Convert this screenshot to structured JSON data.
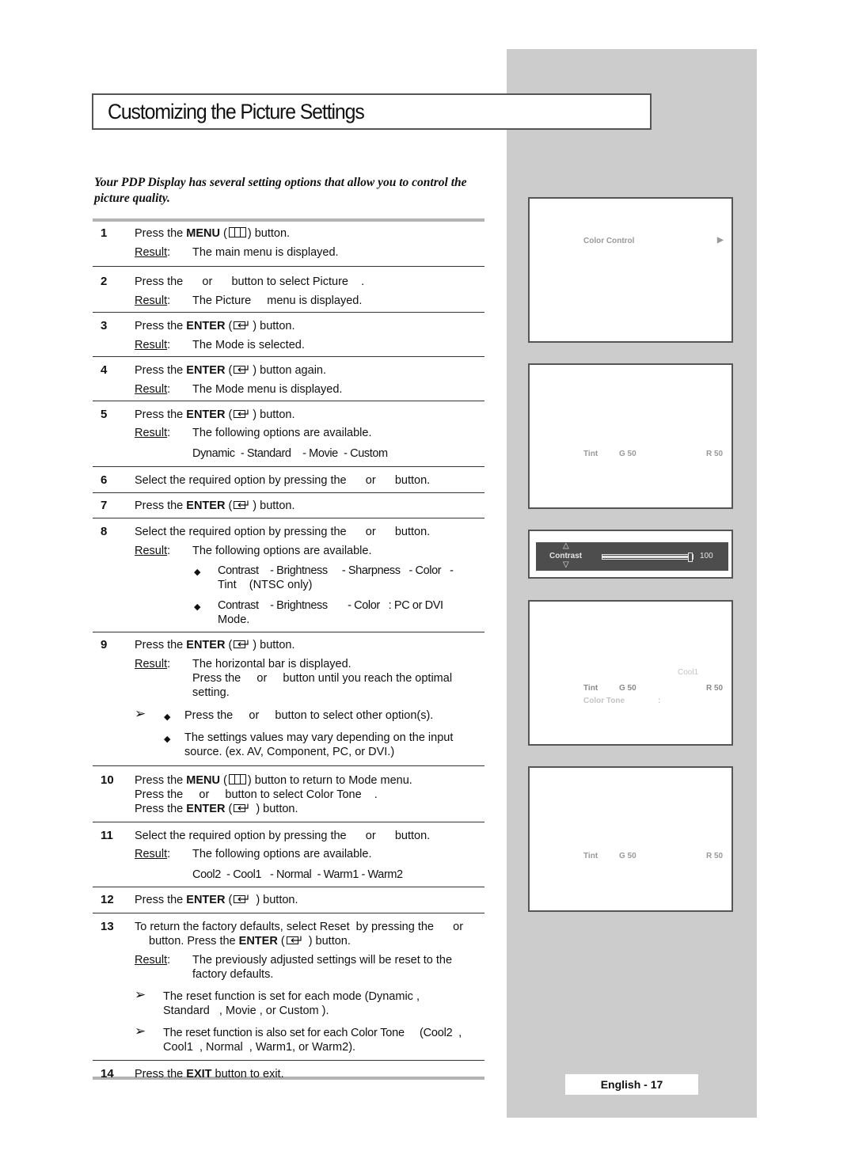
{
  "page": {
    "title": "Customizing the Picture Settings",
    "intro": "Your PDP Display has several setting options that allow you to control the picture quality.",
    "footer_label": "English - 17"
  },
  "icons": {
    "menu": "menu-button-icon",
    "enter": "enter-button-icon",
    "bullet": "◆",
    "note": "➢"
  },
  "steps": [
    {
      "num": "1",
      "l1a": "Press the ",
      "l1b": "MENU",
      "l1c": " (",
      "l1d": ") button.",
      "result_label": "Result",
      "colon": ":",
      "result": "The main menu is displayed."
    },
    {
      "num": "2",
      "l1": "Press the      or      button to select Picture    .",
      "result_label": "Result",
      "colon": ":",
      "result": "The Picture     menu is displayed."
    },
    {
      "num": "3",
      "l1a": "Press the ",
      "l1b": "ENTER",
      "l1c": " (",
      "l1d": ") button.",
      "result_label": "Result",
      "colon": ":",
      "result": "The Mode is selected."
    },
    {
      "num": "4",
      "l1a": "Press the ",
      "l1b": "ENTER",
      "l1c": " (",
      "l1d": ") button again.",
      "result_label": "Result",
      "colon": ":",
      "result": "The Mode menu is displayed."
    },
    {
      "num": "5",
      "l1a": "Press the ",
      "l1b": "ENTER",
      "l1c": " (",
      "l1d": ") button.",
      "result_label": "Result",
      "colon": ":",
      "result": "The following options are available.",
      "options": "Dynamic  - Standard    - Movie  - Custom"
    },
    {
      "num": "6",
      "l1": "Select the required option by pressing the      or      button."
    },
    {
      "num": "7",
      "l1a": "Press the ",
      "l1b": "ENTER",
      "l1c": " (",
      "l1d": ") button."
    },
    {
      "num": "8",
      "l1": "Select the required option by pressing the      or      button.",
      "result_label": "Result",
      "colon": ":",
      "result": "The following options are available.",
      "bullets": [
        {
          "l1": "Contrast    - Brightness     - Sharpness   - Color   -",
          "l2": "Tint    (NTSC only)"
        },
        {
          "l1": "Contrast    - Brightness       - Color   : PC or DVI",
          "l2": "Mode."
        }
      ]
    },
    {
      "num": "9",
      "l1a": "Press the ",
      "l1b": "ENTER",
      "l1c": " (",
      "l1d": ") button.",
      "result_label": "Result",
      "colon": ":",
      "result": "The horizontal bar is displayed.",
      "result2": "Press the     or     button until you reach the optimal",
      "result3": "setting.",
      "notes": [
        {
          "l1": "Press the     or     button to select other option(s)."
        },
        {
          "l1": "The settings values may vary depending on the input",
          "l2": "source. (ex. AV, Component, PC, or DVI.)"
        }
      ]
    },
    {
      "num": "10",
      "l1a": "Press the ",
      "l1b": "MENU",
      "l1c": " (",
      "l1d": ") button to return to Mode menu.",
      "l2": "Press the     or     button to select Color Tone    .",
      "l3a": "Press the ",
      "l3b": "ENTER",
      "l3c": " (",
      "l3d": " ) button."
    },
    {
      "num": "11",
      "l1": "Select the required option by pressing the      or      button.",
      "result_label": "Result",
      "colon": ":",
      "result": "The following options are available.",
      "options": "Cool2  - Cool1   - Normal  - Warm1 - Warm2"
    },
    {
      "num": "12",
      "l1a": "Press the ",
      "l1b": "ENTER",
      "l1c": " (",
      "l1d": " ) button."
    },
    {
      "num": "13",
      "l1": "To return the factory defaults, select Reset  by pressing the      or",
      "l2a": "button. Press the ",
      "l2b": "ENTER",
      "l2c": " (",
      "l2d": " ) button.",
      "result_label": "Result",
      "colon": ":",
      "result": "The previously adjusted settings will be reset to the",
      "result2": "factory defaults.",
      "notes": [
        {
          "l1": "The reset function is set for each mode (Dynamic ,",
          "l2": "Standard   , Movie , or Custom )."
        },
        {
          "l1": "The reset function is also set for each Color Tone     (Cool2  ,",
          "l2": "Cool1  , Normal  , Warm1, or Warm2)."
        }
      ]
    },
    {
      "num": "14",
      "l1a": "Press the ",
      "l1b": "EXIT",
      "l1c": " button to exit."
    }
  ],
  "screens": [
    {
      "item": "Color Control",
      "arrow": "▶"
    },
    {
      "label": "Tint",
      "g": "G 50",
      "r": "R 50"
    },
    {
      "label": "Contrast",
      "value": "100",
      "level_percent": 100,
      "up": "△",
      "down": "▽"
    },
    {
      "extra": "Cool1",
      "label": "Tint",
      "g": "G 50",
      "r": "R 50",
      "tone_label": "Color Tone",
      "tone_colon": ":"
    },
    {
      "label": "Tint",
      "g": "G 50",
      "r": "R 50"
    }
  ]
}
